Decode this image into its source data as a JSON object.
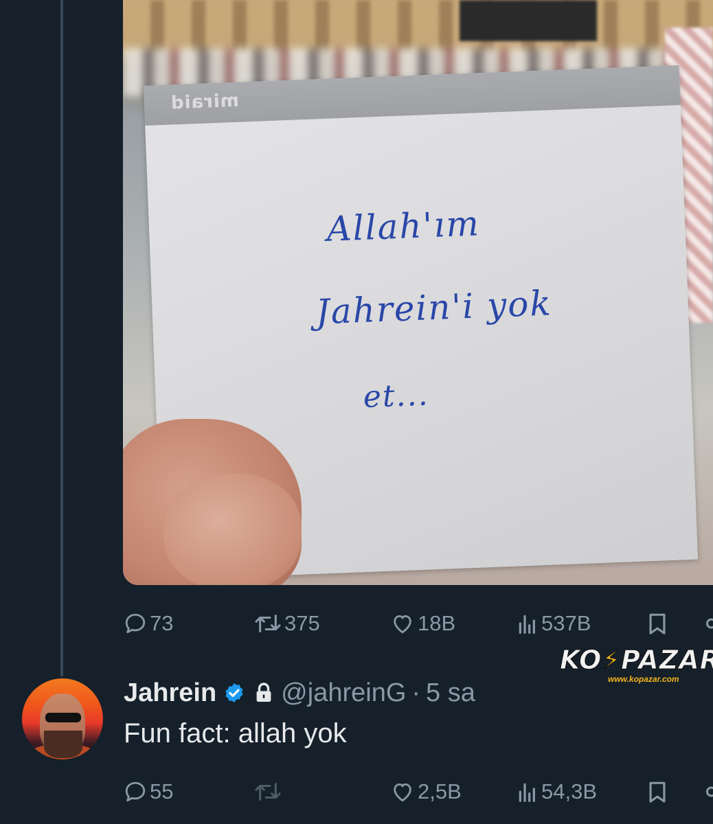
{
  "note": {
    "brand": "miraid",
    "line1": "Allah'ım",
    "line2": "Jahrein'i yok",
    "line3": "et..."
  },
  "first_tweet_actions": {
    "replies": "73",
    "retweets": "375",
    "likes": "18B",
    "views": "537B"
  },
  "watermark": {
    "logo_left": "KO",
    "logo_right": "PAZAR",
    "url": "www.kopazar.com"
  },
  "second_tweet": {
    "name": "Jahrein",
    "handle": "@jahreinG",
    "separator": "·",
    "time": "5 sa",
    "text": "Fun fact: allah yok",
    "actions": {
      "replies": "55",
      "retweets": "",
      "likes": "2,5B",
      "views": "54,3B"
    }
  },
  "colors": {
    "background": "#15202b",
    "muted_text": "#8b98a5",
    "verified": "#1d9bf0",
    "ink": "#2a47a8"
  }
}
